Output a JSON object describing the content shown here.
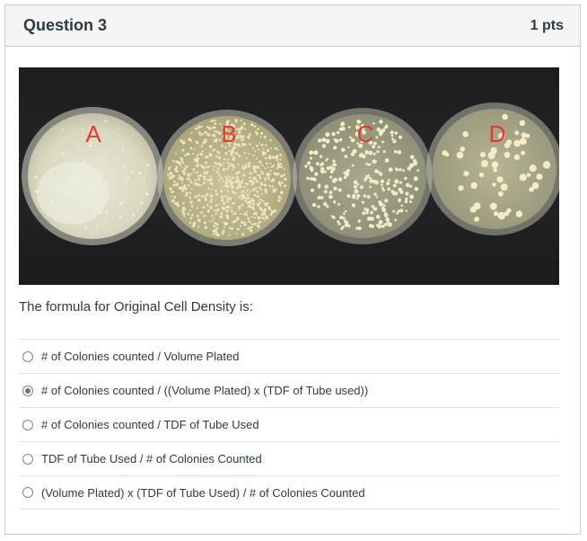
{
  "question": {
    "title": "Question 3",
    "points": "1 pts",
    "prompt": "The formula for Original Cell Density is:"
  },
  "image": {
    "plate_labels": [
      "A",
      "B",
      "C",
      "D"
    ],
    "label_color": "#e8392e"
  },
  "answers": [
    {
      "label": "# of Colonies counted / Volume Plated",
      "selected": false
    },
    {
      "label": "# of Colonies counted / ((Volume Plated) x (TDF of Tube used))",
      "selected": true
    },
    {
      "label": "# of Colonies counted / TDF of Tube Used",
      "selected": false
    },
    {
      "label": "TDF of Tube Used / # of Colonies Counted",
      "selected": false
    },
    {
      "label": "(Volume Plated) x (TDF of Tube Used) / # of Colonies Counted",
      "selected": false
    }
  ]
}
